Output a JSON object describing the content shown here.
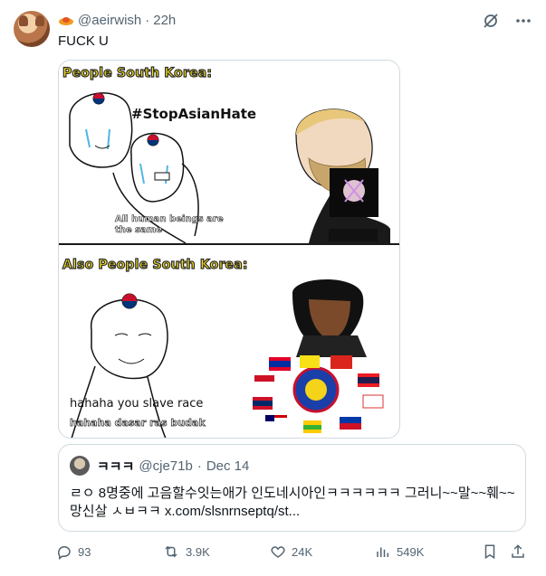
{
  "author": {
    "handle": "@aeirwish",
    "time": "22h",
    "separator": "·"
  },
  "tweet": {
    "text": "FUCK U"
  },
  "media": {
    "panel1_title": "People South Korea:",
    "panel1_hashtag": "#StopAsianHate",
    "panel1_caption_line1": "All human beings are",
    "panel1_caption_line2": "the same",
    "panel2_title": "Also People South Korea:",
    "panel2_caption": "hahaha you slave race",
    "panel2_subcaption": "hahaha dasar ras budak"
  },
  "quote": {
    "name": "ㅋㅋㅋ",
    "handle": "@cje71b",
    "separator": "·",
    "date": "Dec 14",
    "text": "ㄹㅇ 8명중에 고음할수잇는애가 인도네시아인ㅋㅋㅋㅋㅋㅋ 그러니~~말~~훼~~ 망신살 ㅅㅂㅋㅋ x.com/slsnrnseptq/st..."
  },
  "actions": {
    "replies": "93",
    "reposts": "3.9K",
    "likes": "24K",
    "views": "549K"
  },
  "icons": {
    "grok": "grok-icon",
    "more": "more-icon",
    "reply": "reply-icon",
    "repost": "repost-icon",
    "like": "heart-icon",
    "views": "views-icon",
    "bookmark": "bookmark-icon",
    "share": "share-icon"
  },
  "colors": {
    "text_secondary": "#536471",
    "border": "#cfd9de",
    "title_yellow": "#f5e01c"
  }
}
